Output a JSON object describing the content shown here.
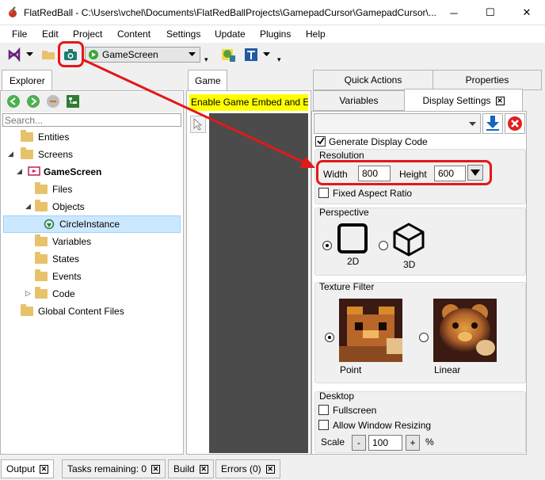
{
  "window": {
    "title": "FlatRedBall - C:\\Users\\vchel\\Documents\\FlatRedBallProjects\\GamepadCursor\\GamepadCursor\\...",
    "minimize": "─",
    "maximize": "☐",
    "close": "✕"
  },
  "menu": [
    "File",
    "Edit",
    "Project",
    "Content",
    "Settings",
    "Update",
    "Plugins",
    "Help"
  ],
  "toolbar": {
    "screen_combo_value": "GameScreen"
  },
  "explorer": {
    "tab_label": "Explorer",
    "search_placeholder": "Search...",
    "tree": [
      {
        "label": "Entities"
      },
      {
        "label": "Screens"
      },
      {
        "label": "GameScreen"
      },
      {
        "label": "Files"
      },
      {
        "label": "Objects"
      },
      {
        "label": "CircleInstance"
      },
      {
        "label": "Variables"
      },
      {
        "label": "States"
      },
      {
        "label": "Events"
      },
      {
        "label": "Code"
      },
      {
        "label": "Global Content Files"
      }
    ]
  },
  "game": {
    "tab_label": "Game",
    "banner": "Enable Game Embed and Edit"
  },
  "right": {
    "tabs": [
      "Quick Actions",
      "Properties",
      "Variables",
      "Display Settings"
    ],
    "generate_label": "Generate Display Code",
    "resolution": {
      "group_label": "Resolution",
      "width_label": "Width",
      "width_value": "800",
      "height_label": "Height",
      "height_value": "600",
      "fixed_aspect": "Fixed Aspect Ratio"
    },
    "perspective": {
      "group_label": "Perspective",
      "opt_2d": "2D",
      "opt_3d": "3D"
    },
    "texture": {
      "group_label": "Texture Filter",
      "point": "Point",
      "linear": "Linear"
    },
    "desktop": {
      "group_label": "Desktop",
      "fullscreen": "Fullscreen",
      "resizing": "Allow Window Resizing",
      "scale_label": "Scale",
      "scale_minus": "-",
      "scale_value": "100",
      "scale_plus": "+",
      "scale_unit": "%"
    }
  },
  "bottom_tabs": [
    "Output",
    "Tasks remaining: 0",
    "Build",
    "Errors (0)"
  ],
  "colors": {
    "annotation": "#e31818",
    "banner": "#ffff00",
    "game_bg": "#4b4b4b"
  }
}
